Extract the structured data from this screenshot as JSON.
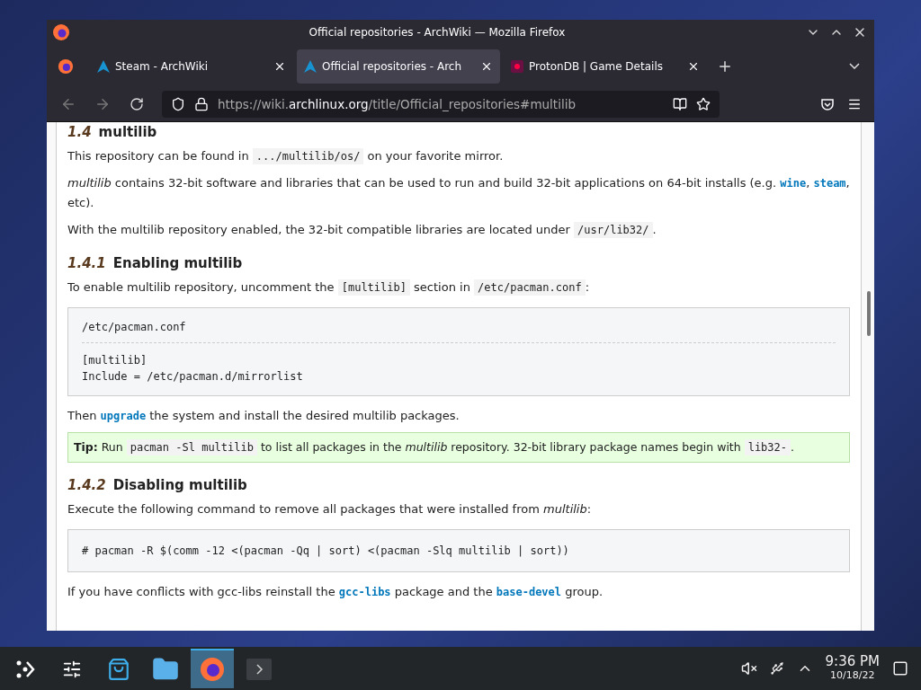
{
  "window": {
    "title": "Official repositories - ArchWiki — Mozilla Firefox"
  },
  "tabs": [
    {
      "label": "Steam - ArchWiki",
      "kind": "arch",
      "selected": false
    },
    {
      "label": "Official repositories - Arch",
      "kind": "arch",
      "selected": true
    },
    {
      "label": "ProtonDB | Game Details",
      "kind": "proton",
      "selected": false
    }
  ],
  "address": {
    "prefix": "https://wiki.",
    "domain": "archlinux.org",
    "path": "/title/Official_repositories#multilib"
  },
  "content": [
    {
      "kind": "heading",
      "number": "1.4",
      "title": "multilib"
    },
    {
      "kind": "para",
      "parts": [
        {
          "kind": "text",
          "text": "This repository can be found in "
        },
        {
          "kind": "code",
          "text": ".../multilib/os/"
        },
        {
          "kind": "text",
          "text": " on your favorite mirror."
        }
      ]
    },
    {
      "kind": "para",
      "parts": [
        {
          "kind": "em",
          "text": "multilib"
        },
        {
          "kind": "text",
          "text": " contains 32-bit software and libraries that can be used to run and build 32-bit applications on 64-bit installs (e.g. "
        },
        {
          "kind": "link",
          "text": "wine"
        },
        {
          "kind": "text",
          "text": ", "
        },
        {
          "kind": "link",
          "text": "steam"
        },
        {
          "kind": "text",
          "text": ", etc)."
        }
      ]
    },
    {
      "kind": "para",
      "parts": [
        {
          "kind": "text",
          "text": "With the multilib repository enabled, the 32-bit compatible libraries are located under "
        },
        {
          "kind": "code",
          "text": "/usr/lib32/"
        },
        {
          "kind": "text",
          "text": "."
        }
      ]
    },
    {
      "kind": "heading",
      "number": "1.4.1",
      "title": "Enabling multilib"
    },
    {
      "kind": "para",
      "parts": [
        {
          "kind": "text",
          "text": "To enable multilib repository, uncomment the "
        },
        {
          "kind": "code",
          "text": "[multilib]"
        },
        {
          "kind": "text",
          "text": " section in "
        },
        {
          "kind": "code",
          "text": "/etc/pacman.conf"
        },
        {
          "kind": "text",
          "text": ":"
        }
      ]
    },
    {
      "kind": "file",
      "name": "/etc/pacman.conf",
      "lines": [
        "[multilib]",
        "Include = /etc/pacman.d/mirrorlist"
      ]
    },
    {
      "kind": "para",
      "parts": [
        {
          "kind": "text",
          "text": "Then "
        },
        {
          "kind": "link",
          "text": "upgrade"
        },
        {
          "kind": "text",
          "text": " the system and install the desired multilib packages."
        }
      ]
    },
    {
      "kind": "tip",
      "label": "Tip:",
      "parts": [
        {
          "kind": "text",
          "text": " Run "
        },
        {
          "kind": "code",
          "text": "pacman -Sl multilib"
        },
        {
          "kind": "text",
          "text": " to list all packages in the "
        },
        {
          "kind": "em",
          "text": "multilib"
        },
        {
          "kind": "text",
          "text": " repository. 32-bit library package names begin with "
        },
        {
          "kind": "code",
          "text": "lib32-"
        },
        {
          "kind": "text",
          "text": "."
        }
      ]
    },
    {
      "kind": "heading",
      "number": "1.4.2",
      "title": "Disabling multilib"
    },
    {
      "kind": "para",
      "parts": [
        {
          "kind": "text",
          "text": "Execute the following command to remove all packages that were installed from "
        },
        {
          "kind": "em",
          "text": "multilib"
        },
        {
          "kind": "text",
          "text": ":"
        }
      ]
    },
    {
      "kind": "code",
      "lines": [
        "# pacman -R $(comm -12 <(pacman -Qq | sort) <(pacman -Slq multilib | sort))"
      ]
    },
    {
      "kind": "para",
      "parts": [
        {
          "kind": "text",
          "text": "If you have conflicts with gcc-libs reinstall the "
        },
        {
          "kind": "link",
          "text": "gcc-libs"
        },
        {
          "kind": "text",
          "text": " package and the "
        },
        {
          "kind": "link",
          "text": "base-devel"
        },
        {
          "kind": "text",
          "text": " group."
        }
      ]
    }
  ],
  "clock": {
    "time": "9:36 PM",
    "date": "10/18/22"
  },
  "taskbar": [
    {
      "kind": "launcher",
      "selected": false
    },
    {
      "kind": "settings",
      "selected": false
    },
    {
      "kind": "store",
      "selected": false
    },
    {
      "kind": "files",
      "selected": false
    },
    {
      "kind": "firefox",
      "selected": true
    },
    {
      "kind": "terminal",
      "selected": false
    }
  ]
}
